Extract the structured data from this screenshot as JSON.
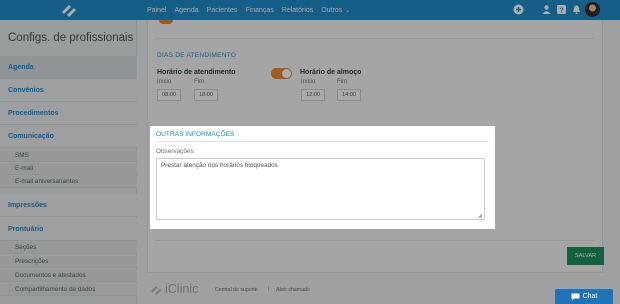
{
  "topbar": {
    "nav": [
      "Painel",
      "Agenda",
      "Pacientes",
      "Finanças",
      "Relatórios",
      "Outros"
    ],
    "colors": {
      "bar": "#1f8bc7",
      "accent": "#e8862a",
      "save": "#1d8f5e",
      "chat": "#1f73b6"
    },
    "icons": [
      "plus-icon",
      "user-icon",
      "help-icon",
      "notification-bell-icon"
    ]
  },
  "sidebar": {
    "title": "Configs. de profissionais",
    "items": [
      {
        "label": "Agenda"
      },
      {
        "label": "Convênios"
      },
      {
        "label": "Procedimentos"
      },
      {
        "label": "Comunicação"
      },
      {
        "label": "SMS"
      },
      {
        "label": "E-mail"
      },
      {
        "label": "E-mail aniversariantes"
      },
      {
        "label": "Impressões"
      },
      {
        "label": "Prontuário"
      },
      {
        "label": "Seções"
      },
      {
        "label": "Prescrições"
      },
      {
        "label": "Documentos e atestados"
      },
      {
        "label": "Compartilhamento de dados"
      }
    ]
  },
  "schedule": {
    "section_title": "DIAS DE ATENDIMENTO",
    "work_hours_label": "Horário de atendimento",
    "lunch_label": "Horário de almoço",
    "start_label": "Início",
    "end_label": "Fim",
    "work_start": "08:00",
    "work_end": "18:00",
    "lunch_start": "12:00",
    "lunch_end": "14:00",
    "lunch_enabled": true
  },
  "other_info": {
    "section_title": "OUTRAS INFORMAÇÕES",
    "observations_label": "Observações",
    "observations_value": "Prestar atenção nos horários bloqueados"
  },
  "actions": {
    "save_label": "SALVAR"
  },
  "footer": {
    "brand": "iClinic",
    "support_link": "Central de suporte",
    "separator": "|",
    "ticket_link": "Abrir chamado",
    "chat_label": "Chat"
  }
}
